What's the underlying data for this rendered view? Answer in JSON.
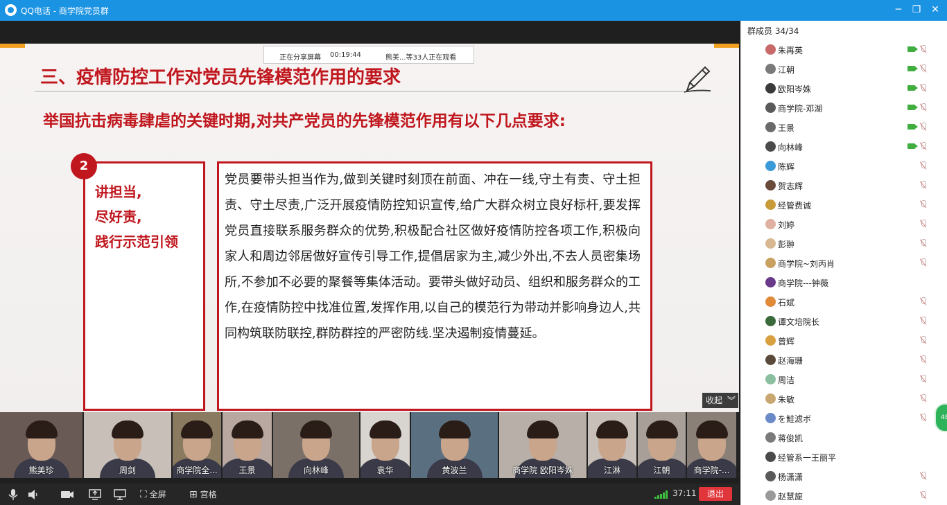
{
  "window": {
    "title": "QQ电话 - 商学院党员群",
    "minimize_glyph": "─",
    "restore_glyph": "❐",
    "close_glyph": "✕"
  },
  "share_banner": {
    "status": "正在分享屏幕",
    "elapsed": "00:19:44",
    "viewers": "熊美...等33人正在观看"
  },
  "slide": {
    "heading": "三、疫情防控工作对党员先锋模范作用的要求",
    "subtitle": "举国抗击病毒肆虐的关键时期,对共产党员的先锋模范作用有以下几点要求:",
    "badge": "2",
    "left_text": "讲担当,\n尽好责,\n践行示范引领",
    "body": "党员要带头担当作为,做到关键时刻顶在前面、冲在一线,守土有责、守土担责、守土尽责,广泛开展疫情防控知识宣传,给广大群众树立良好标杆,要发挥党员直接联系服务群众的优势,积极配合社区做好疫情防控各项工作,积极向家人和周边邻居做好宣传引导工作,提倡居家为主,减少外出,不去人员密集场所,不参加不必要的聚餐等集体活动。要带头做好动员、组织和服务群众的工作,在疫情防控中找准位置,发挥作用,以自己的模范行为带动并影响身边人,共同构筑联防联控,群防群控的严密防线.坚决遏制疫情蔓延。"
  },
  "collapse_label": "收起",
  "videos": [
    {
      "name": "熊美珍",
      "bg": "#6a5a55"
    },
    {
      "name": "周剑",
      "bg": "#c8c0b8"
    },
    {
      "name": "商学院全...",
      "bg": "#8a7a60"
    },
    {
      "name": "王景",
      "bg": "#b8a8a0"
    },
    {
      "name": "向林峰",
      "bg": "#7a7068"
    },
    {
      "name": "袁华",
      "bg": "#d8d4d0"
    },
    {
      "name": "黄波兰",
      "bg": "#5a7080"
    },
    {
      "name": "商学院 欧阳岑姝",
      "bg": "#b8b0a8"
    },
    {
      "name": "江淋",
      "bg": "#c8c0b8"
    },
    {
      "name": "江朝",
      "bg": "#a8a098"
    },
    {
      "name": "商学院-...",
      "bg": "#8a8078"
    }
  ],
  "toolbar": {
    "fullscreen": "全屏",
    "grid": "宫格",
    "timer": "37:11",
    "exit": "退出"
  },
  "members": {
    "header": "群成员 34/34",
    "list": [
      {
        "name": "朱再英",
        "video": true,
        "color": "#c86a6a"
      },
      {
        "name": "江朝",
        "video": true,
        "color": "#7a7a7a"
      },
      {
        "name": "欧阳岑姝",
        "video": true,
        "color": "#3a3a3a"
      },
      {
        "name": "商学院-邓湖",
        "video": true,
        "color": "#5a5a5a"
      },
      {
        "name": "王景",
        "video": true,
        "color": "#6a6a6a"
      },
      {
        "name": "向林峰",
        "video": true,
        "color": "#4a4a4a"
      },
      {
        "name": "陈辉",
        "video": false,
        "color": "#3a9ad8"
      },
      {
        "name": "贺志辉",
        "video": false,
        "color": "#6a4a3a"
      },
      {
        "name": "经管费诚",
        "video": false,
        "color": "#c89a3a"
      },
      {
        "name": "刘婷",
        "video": false,
        "color": "#e0b0a0"
      },
      {
        "name": "彭翀",
        "video": false,
        "color": "#d8b890"
      },
      {
        "name": "商学院~刘丙肖",
        "video": false,
        "color": "#c8a060"
      },
      {
        "name": "商学院---钟薇",
        "video": false,
        "color": "#6a3a8a"
      },
      {
        "name": "石斌",
        "video": false,
        "color": "#e08a3a"
      },
      {
        "name": "谭文培院长",
        "video": false,
        "color": "#3a6a3a"
      },
      {
        "name": "曾辉",
        "video": false,
        "color": "#d8a040"
      },
      {
        "name": "赵海珊",
        "video": false,
        "color": "#5a4a3a"
      },
      {
        "name": "周洁",
        "video": false,
        "color": "#8ac0a0"
      },
      {
        "name": "朱敏",
        "video": false,
        "color": "#c8a870"
      },
      {
        "name": "を鮭滤ボ",
        "video": false,
        "color": "#6a8ac8"
      },
      {
        "name": "蒋俊凯",
        "video": false,
        "color": "#7a7a7a"
      },
      {
        "name": "经管系一王丽平",
        "video": false,
        "color": "#4a4a4a"
      },
      {
        "name": "杨潇潇",
        "video": false,
        "color": "#5a5a5a"
      },
      {
        "name": "赵慧旎",
        "video": false,
        "color": "#9a9a9a"
      }
    ]
  },
  "float_badge": "48"
}
